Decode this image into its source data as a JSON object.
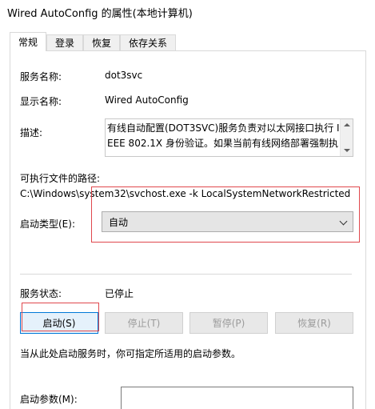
{
  "window": {
    "title": "Wired AutoConfig 的属性(本地计算机)"
  },
  "tabs": [
    {
      "label": "常规",
      "active": true
    },
    {
      "label": "登录",
      "active": false
    },
    {
      "label": "恢复",
      "active": false
    },
    {
      "label": "依存关系",
      "active": false
    }
  ],
  "general": {
    "service_name_label": "服务名称:",
    "service_name_value": "dot3svc",
    "display_name_label": "显示名称:",
    "display_name_value": "Wired AutoConfig",
    "description_label": "描述:",
    "description_value": "有线自动配置(DOT3SVC)服务负责对以太网接口执行 IEEE 802.1X 身份验证。如果当前有线网络部署强制执",
    "exe_path_label": "可执行文件的路径:",
    "exe_path_value": "C:\\Windows\\system32\\svchost.exe -k LocalSystemNetworkRestricted",
    "startup_type_label": "启动类型(E):",
    "startup_type_value": "自动",
    "status_label": "服务状态:",
    "status_value": "已停止",
    "buttons": {
      "start": "启动(S)",
      "stop": "停止(T)",
      "pause": "暂停(P)",
      "resume": "恢复(R)"
    },
    "hint": "当从此处启动服务时，你可指定所适用的启动参数。",
    "start_params_label": "启动参数(M):",
    "start_params_value": ""
  },
  "colors": {
    "highlight_box": "#e0484d",
    "focus_border": "#0078d7"
  }
}
